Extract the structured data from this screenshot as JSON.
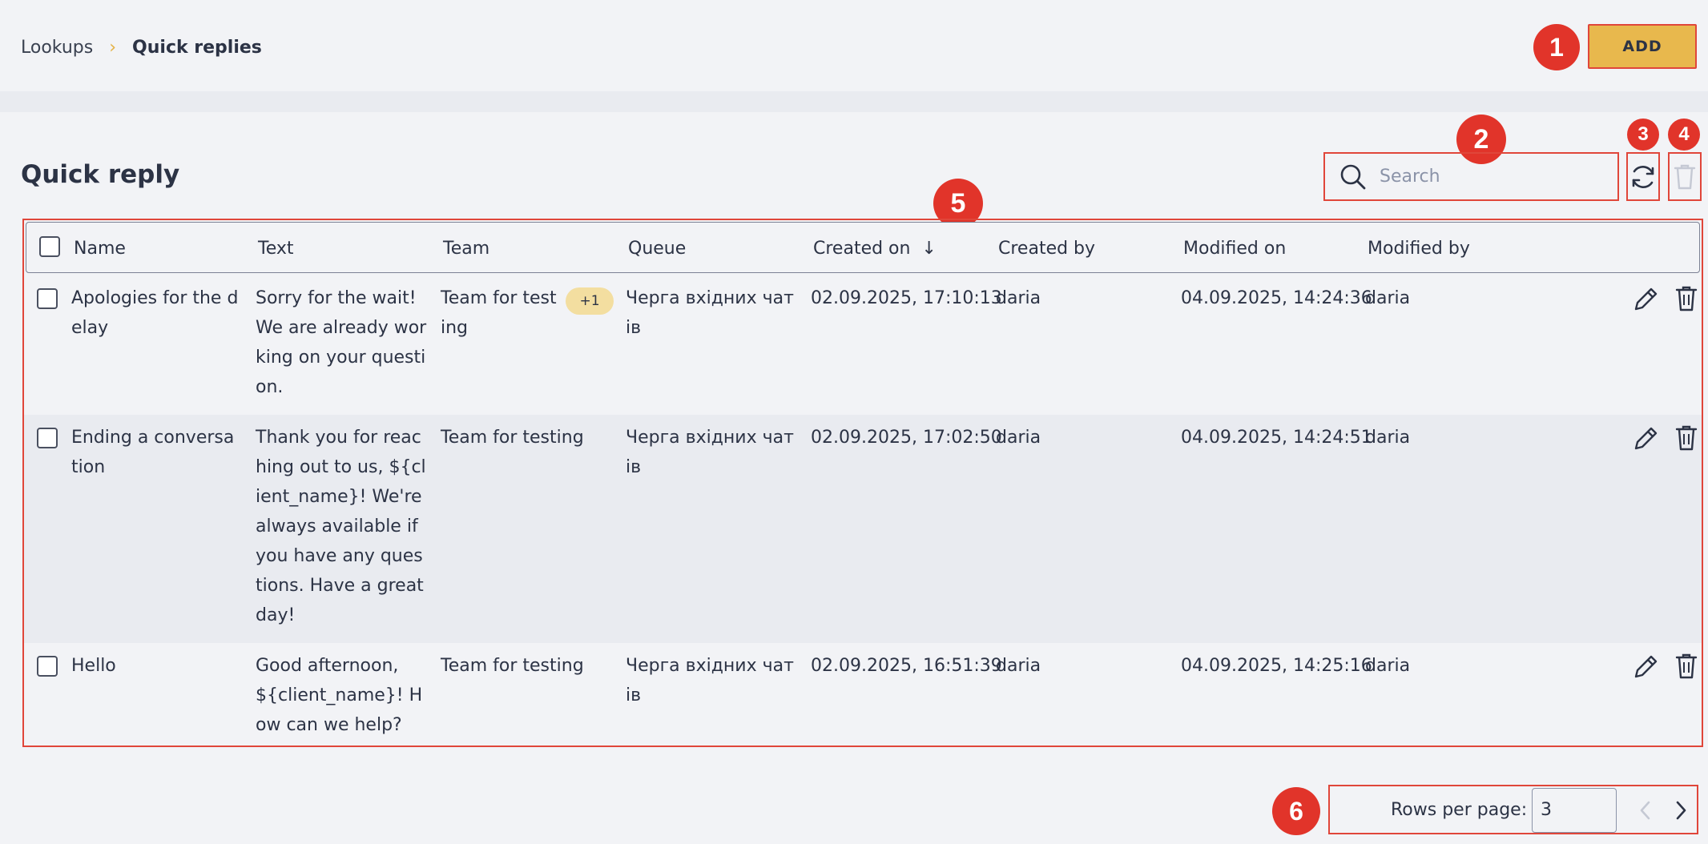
{
  "breadcrumb": {
    "root": "Lookups",
    "separator": "›",
    "current": "Quick replies"
  },
  "toolbar": {
    "add_label": "ADD"
  },
  "page": {
    "title": "Quick reply"
  },
  "search": {
    "placeholder": "Search",
    "value": ""
  },
  "table": {
    "headers": {
      "name": "Name",
      "text": "Text",
      "team": "Team",
      "queue": "Queue",
      "created_on": "Created on",
      "created_by": "Created by",
      "modified_on": "Modified on",
      "modified_by": "Modified by"
    },
    "sort_arrow": "↓",
    "rows": [
      {
        "name": "Apologies for the delay",
        "text": "Sorry for the wait! We are already working on your question.",
        "team": "Team for testing",
        "team_extra": "+1",
        "queue": "Черга вхідних чатів",
        "created_on": "02.09.2025, 17:10:13",
        "created_by": "daria",
        "modified_on": "04.09.2025, 14:24:36",
        "modified_by": "daria"
      },
      {
        "name": "Ending a conversation",
        "text": "Thank you for reaching out to us, ${client_name}! We're always available if you have any questions. Have a great day!",
        "team": "Team for testing",
        "team_extra": "",
        "queue": "Черга вхідних чатів",
        "created_on": "02.09.2025, 17:02:50",
        "created_by": "daria",
        "modified_on": "04.09.2025, 14:24:51",
        "modified_by": "daria"
      },
      {
        "name": "Hello",
        "text": "Good afternoon, ${client_name}! How can we help?",
        "team": "Team for testing",
        "team_extra": "",
        "queue": "Черга вхідних чатів",
        "created_on": "02.09.2025, 16:51:39",
        "created_by": "daria",
        "modified_on": "04.09.2025, 14:25:16",
        "modified_by": "daria"
      }
    ]
  },
  "pagination": {
    "rows_per_page_label": "Rows per page:",
    "rows_per_page": "3"
  },
  "markers": [
    "1",
    "2",
    "3",
    "4",
    "5",
    "6"
  ],
  "colors": {
    "accent": "#e8b84d",
    "marker": "#e1342a",
    "highlight_border": "#e0463a"
  }
}
